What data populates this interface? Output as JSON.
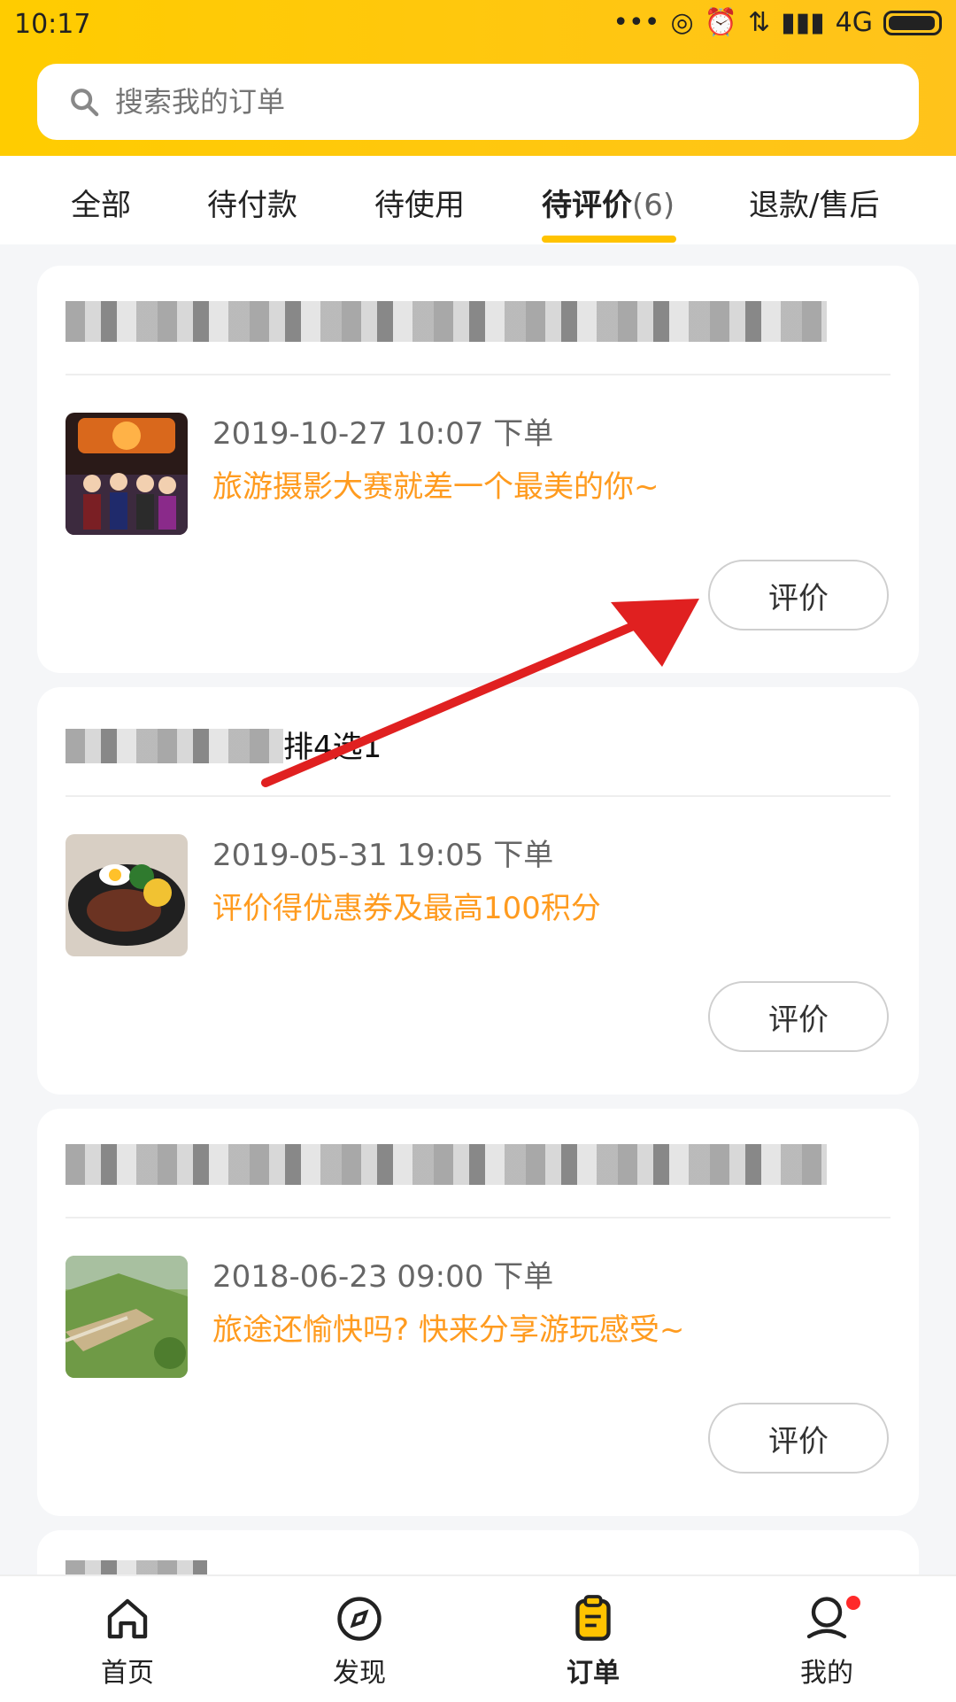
{
  "status_bar": {
    "time": "10:17",
    "network": "4G"
  },
  "search": {
    "placeholder": "搜索我的订单"
  },
  "tabs": [
    {
      "label": "全部"
    },
    {
      "label": "待付款"
    },
    {
      "label": "待使用"
    },
    {
      "label": "待评价",
      "count": "(6)",
      "active": true
    },
    {
      "label": "退款/售后"
    }
  ],
  "orders": [
    {
      "title_visible": "",
      "order_time": "2019-10-27 10:07 下单",
      "promo": "旅游摄影大赛就差一个最美的你~",
      "button": "评价"
    },
    {
      "title_visible": "排4选1",
      "order_time": "2019-05-31 19:05 下单",
      "promo": "评价得优惠券及最高100积分",
      "button": "评价"
    },
    {
      "title_visible": "",
      "order_time": "2018-06-23 09:00 下单",
      "promo": "旅途还愉快吗? 快来分享游玩感受~",
      "button": "评价"
    }
  ],
  "bottom_nav": [
    {
      "label": "首页",
      "icon": "home-icon"
    },
    {
      "label": "发现",
      "icon": "compass-icon"
    },
    {
      "label": "订单",
      "icon": "order-icon",
      "active": true
    },
    {
      "label": "我的",
      "icon": "profile-icon",
      "badge": true
    }
  ],
  "colors": {
    "accent": "#ffc300",
    "promo": "#ff9b1f",
    "arrow": "#e02020"
  }
}
